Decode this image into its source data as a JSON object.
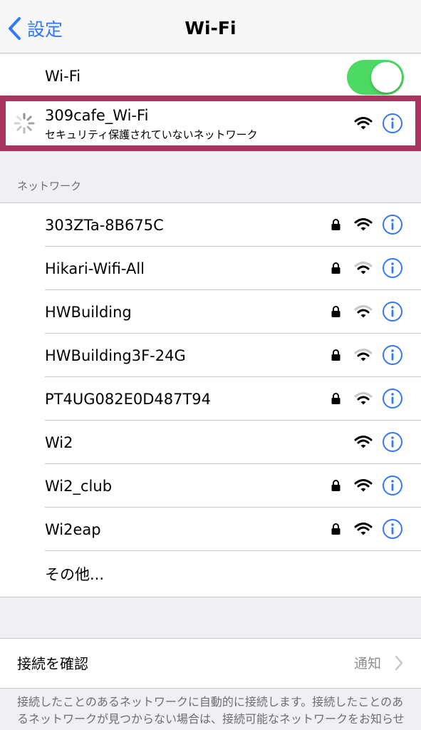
{
  "nav": {
    "back_label": "設定",
    "title": "Wi-Fi"
  },
  "wifi_toggle": {
    "label": "Wi-Fi",
    "on": true
  },
  "current": {
    "name": "309cafe_Wi-Fi",
    "subtitle": "セキュリティ保護されていないネットワーク",
    "status": "connecting"
  },
  "section_header": "ネットワーク",
  "networks": [
    {
      "name": "303ZTa-8B675C",
      "locked": true,
      "signal": "full"
    },
    {
      "name": "Hikari-Wifi-All",
      "locked": true,
      "signal": "weak"
    },
    {
      "name": "HWBuilding",
      "locked": true,
      "signal": "weak"
    },
    {
      "name": "HWBuilding3F-24G",
      "locked": true,
      "signal": "weak"
    },
    {
      "name": "PT4UG082E0D487T94",
      "locked": true,
      "signal": "weak"
    },
    {
      "name": "Wi2",
      "locked": false,
      "signal": "full"
    },
    {
      "name": "Wi2_club",
      "locked": true,
      "signal": "full"
    },
    {
      "name": "Wi2eap",
      "locked": true,
      "signal": "full"
    }
  ],
  "other_label": "その他...",
  "verify": {
    "label": "接続を確認",
    "value": "通知"
  },
  "footer": "接続したことのあるネットワークに自動的に接続します。接続したことのあるネットワークが見つからない場合は、接続可能なネットワークをお知らせします。",
  "colors": {
    "accent": "#3478f6",
    "toggle_on": "#4cd964",
    "highlight": "#a8355f"
  }
}
